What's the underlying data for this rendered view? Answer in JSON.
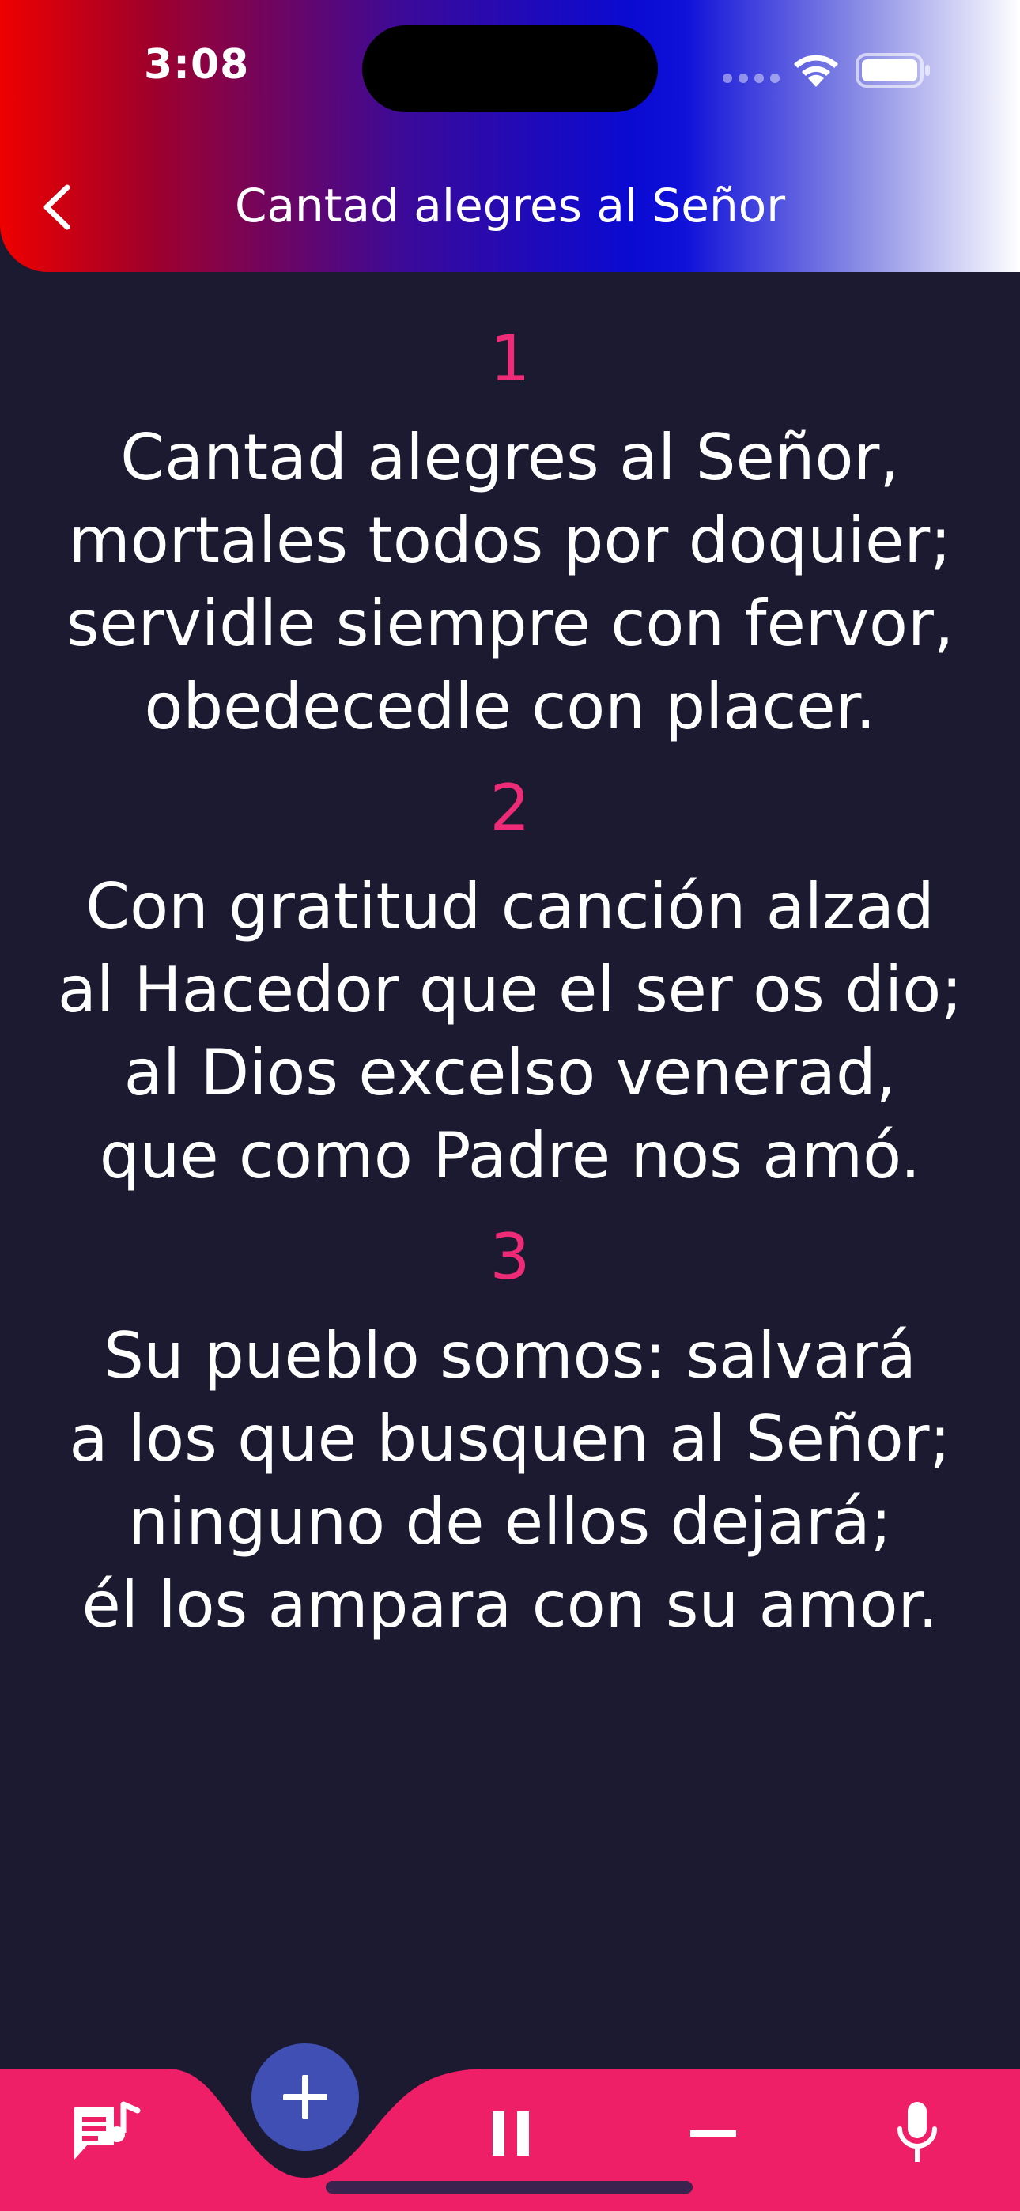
{
  "status_bar": {
    "time": "3:08"
  },
  "header": {
    "title": "Cantad alegres al Señor",
    "back_icon": "chevron-left-icon"
  },
  "stanzas": [
    {
      "number": "1",
      "lines": [
        "Cantad alegres al Señor,",
        "mortales todos por doquier;",
        "servidle siempre con fervor,",
        "obedecedle con placer."
      ]
    },
    {
      "number": "2",
      "lines": [
        "Con gratitud canción alzad",
        "al Hacedor que el ser os dio;",
        "al Dios excelso venerad,",
        "que como Padre nos amó."
      ]
    },
    {
      "number": "3",
      "lines": [
        "Su pueblo somos: salvará",
        "a los que busquen al Señor;",
        "ninguno de ellos dejará;",
        "él los ampara con su amor."
      ]
    }
  ],
  "bottom_bar": {
    "buttons": [
      {
        "icon": "lyrics-note-icon"
      },
      {
        "icon": "plus-icon"
      },
      {
        "icon": "pause-icon"
      },
      {
        "icon": "minus-icon"
      },
      {
        "icon": "microphone-icon"
      }
    ]
  },
  "colors": {
    "background": "#1b1a30",
    "accent_pink": "#ee1f66",
    "stanza_number": "#ee2b76",
    "fab_blue": "#3f4fb3",
    "text": "#ffffff"
  }
}
